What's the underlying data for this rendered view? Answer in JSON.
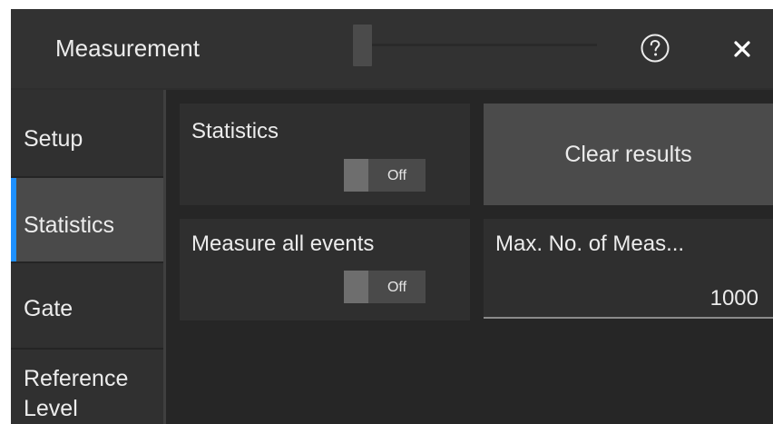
{
  "header": {
    "title": "Measurement",
    "help_icon": "question-circle-icon",
    "close_icon": "close-x-icon"
  },
  "sidebar": {
    "items": [
      {
        "label": "Setup"
      },
      {
        "label": "Statistics",
        "active": true
      },
      {
        "label": "Gate"
      },
      {
        "label": "Reference Level"
      }
    ]
  },
  "statistics_panel": {
    "label": "Statistics",
    "toggle_state": "Off"
  },
  "measure_all_events_panel": {
    "label": "Measure all events",
    "toggle_state": "Off"
  },
  "clear_button": {
    "label": "Clear results"
  },
  "max_meas": {
    "label": "Max. No. of Meas...",
    "value": "1000"
  },
  "colors": {
    "accent": "#1e90ff",
    "background": "#262626",
    "panel": "#2f2f2f",
    "button": "#4b4b4b"
  }
}
